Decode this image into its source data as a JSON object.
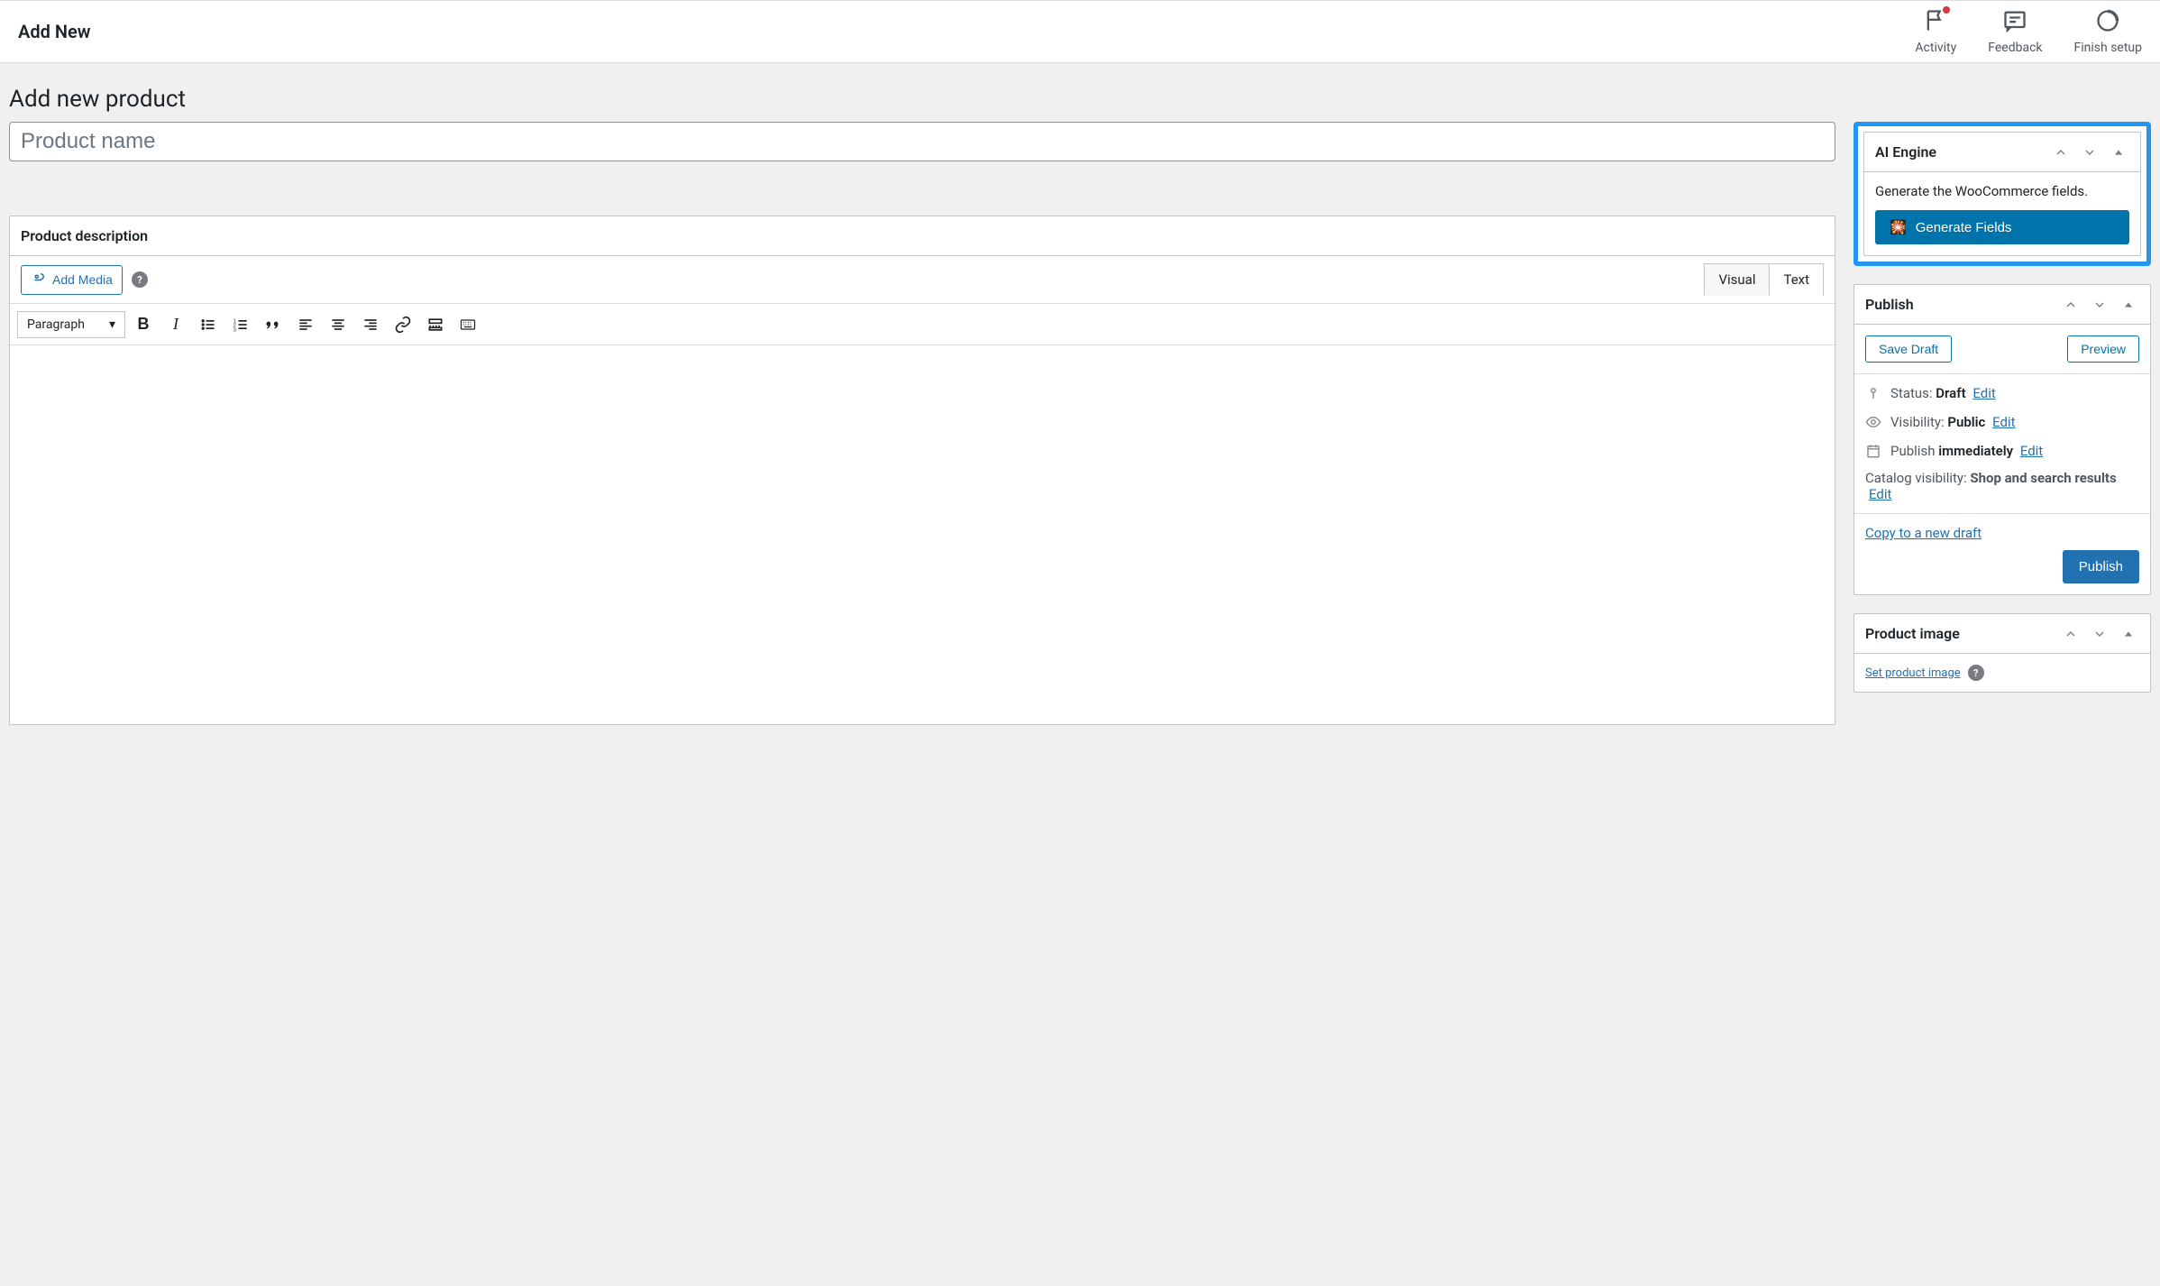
{
  "topbar": {
    "title": "Add New",
    "actions": {
      "activity": "Activity",
      "feedback": "Feedback",
      "finish_setup": "Finish setup"
    }
  },
  "page": {
    "heading": "Add new product",
    "product_name_placeholder": "Product name"
  },
  "editor": {
    "box_title": "Product description",
    "add_media": "Add Media",
    "tab_visual": "Visual",
    "tab_text": "Text",
    "format_select": "Paragraph"
  },
  "ai_engine": {
    "title": "AI Engine",
    "description": "Generate the WooCommerce fields.",
    "button": "Generate Fields",
    "button_icon": "🎇"
  },
  "publish": {
    "title": "Publish",
    "save_draft": "Save Draft",
    "preview": "Preview",
    "status_label": "Status:",
    "status_value": "Draft",
    "visibility_label": "Visibility:",
    "visibility_value": "Public",
    "schedule_label": "Publish",
    "schedule_value": "immediately",
    "catalog_label": "Catalog visibility:",
    "catalog_value": "Shop and search results",
    "edit": "Edit",
    "copy_link": "Copy to a new draft",
    "publish_btn": "Publish"
  },
  "product_image": {
    "title": "Product image",
    "set_link": "Set product image"
  }
}
